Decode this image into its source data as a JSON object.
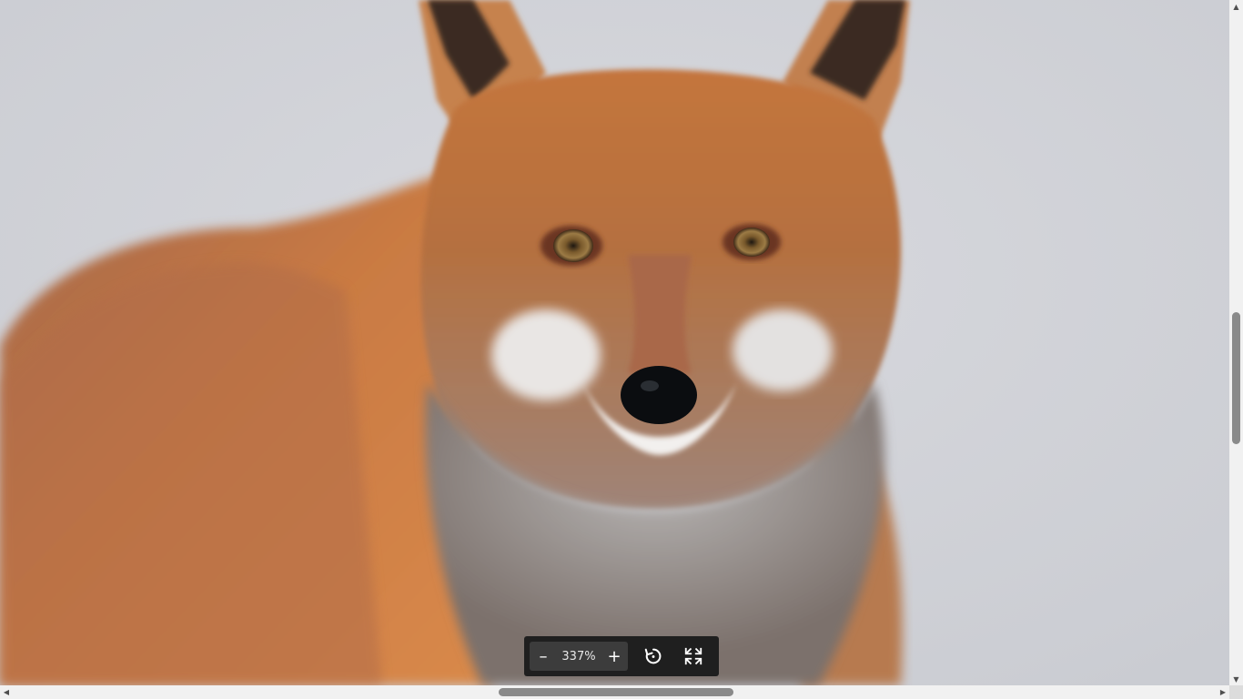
{
  "viewer": {
    "image_alt": "",
    "zoom_level": "337%",
    "zoom_out_symbol": "–",
    "zoom_in_symbol": "+",
    "icons": {
      "zoom_out": "minus-icon",
      "zoom_in": "plus-icon",
      "rotate": "rotate-icon",
      "fit": "collapse-icon"
    }
  },
  "colors": {
    "toolbar_bg": "#1f1f1f",
    "zoom_group_bg": "#3c3c3c",
    "scrollbar_thumb": "#8a8a8a"
  }
}
